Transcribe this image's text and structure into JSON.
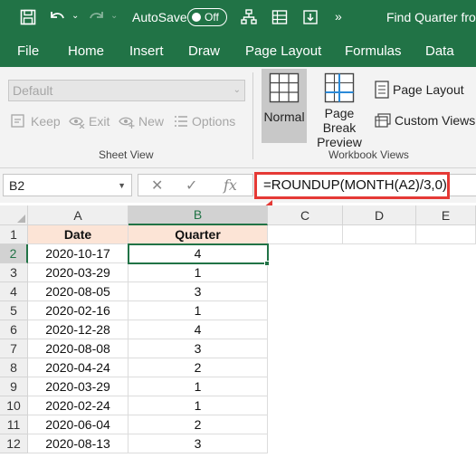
{
  "titlebar": {
    "autosave_label": "AutoSave",
    "autosave_state": "Off",
    "doc_title": "Find Quarter from"
  },
  "menu": [
    "File",
    "Home",
    "Insert",
    "Draw",
    "Page Layout",
    "Formulas",
    "Data"
  ],
  "ribbon": {
    "sheet_view": {
      "style_select": "Default",
      "keep": "Keep",
      "exit": "Exit",
      "new": "New",
      "options": "Options",
      "group_label": "Sheet View"
    },
    "workbook_views": {
      "normal": "Normal",
      "page_break_line1": "Page Break",
      "page_break_line2": "Preview",
      "page_layout": "Page Layout",
      "custom_views": "Custom Views",
      "group_label": "Workbook Views"
    }
  },
  "formula_bar": {
    "name_box": "B2",
    "formula": "=ROUNDUP(MONTH(A2)/3,0)"
  },
  "grid": {
    "columns": [
      "A",
      "B",
      "C",
      "D",
      "E"
    ],
    "rows": [
      "1",
      "2",
      "3",
      "4",
      "5",
      "6",
      "7",
      "8",
      "9",
      "10",
      "11",
      "12"
    ],
    "header": {
      "a": "Date",
      "b": "Quarter"
    },
    "data": [
      {
        "date": "2020-10-17",
        "quarter": "4"
      },
      {
        "date": "2020-03-29",
        "quarter": "1"
      },
      {
        "date": "2020-08-05",
        "quarter": "3"
      },
      {
        "date": "2020-02-16",
        "quarter": "1"
      },
      {
        "date": "2020-12-28",
        "quarter": "4"
      },
      {
        "date": "2020-08-08",
        "quarter": "3"
      },
      {
        "date": "2020-04-24",
        "quarter": "2"
      },
      {
        "date": "2020-03-29",
        "quarter": "1"
      },
      {
        "date": "2020-02-24",
        "quarter": "1"
      },
      {
        "date": "2020-06-04",
        "quarter": "2"
      },
      {
        "date": "2020-08-13",
        "quarter": "3"
      }
    ]
  },
  "colors": {
    "excel_green": "#217346",
    "header_fill": "#fce4d6",
    "annotation_red": "#e53935"
  }
}
